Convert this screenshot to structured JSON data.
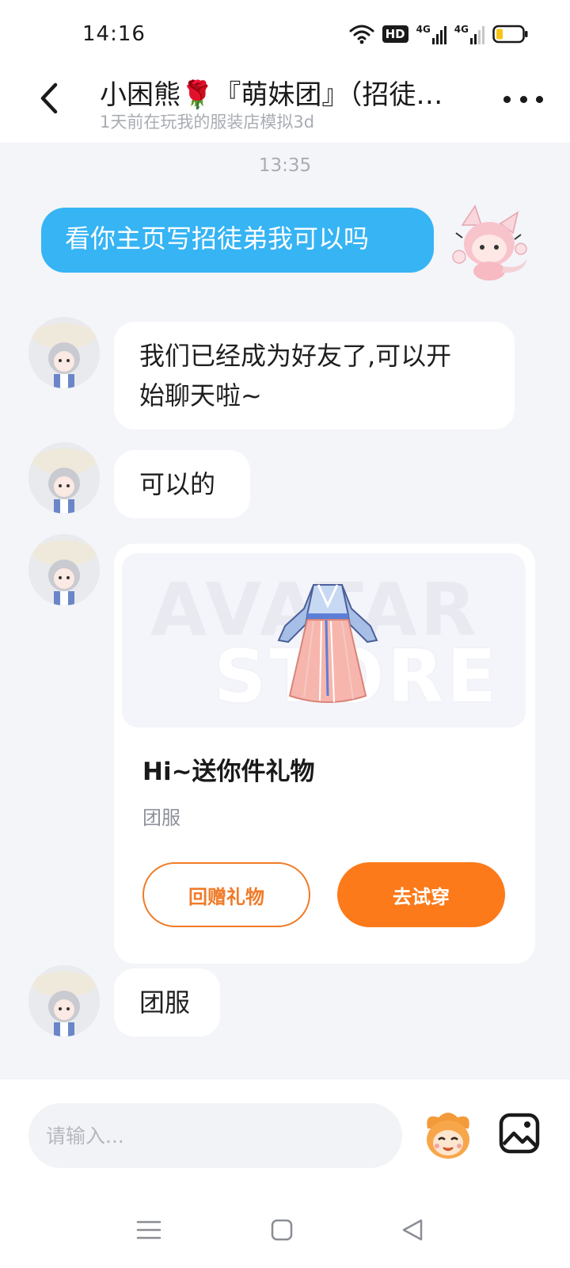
{
  "status_bar": {
    "time": "14:16",
    "network_1": "4G",
    "network_2": "4G",
    "hd_label": "HD"
  },
  "header": {
    "title": "小困熊🌹『萌妹团』（招徒…",
    "subtitle": "1天前在玩我的服装店模拟3d"
  },
  "chat": {
    "timestamp": "13:35",
    "messages": [
      {
        "sender": "me",
        "text": "看你主页写招徒弟我可以吗"
      },
      {
        "sender": "friend",
        "text_line1": "我们已经成为好友了,可以开",
        "text_line2": "始聊天啦~"
      },
      {
        "sender": "friend",
        "text": "可以的"
      },
      {
        "sender": "friend",
        "type": "gift",
        "watermark_1": "AVATAR",
        "watermark_2": "STORE",
        "title": "Hi~送你件礼物",
        "subtitle": "团服",
        "return_button": "回赠礼物",
        "try_button": "去试穿"
      },
      {
        "sender": "friend",
        "text": "团服"
      }
    ]
  },
  "input": {
    "placeholder": "请输入..."
  },
  "colors": {
    "outgoing_bubble": "#36b4f4",
    "accent_orange": "#fc7a1a",
    "background": "#f3f5f9"
  },
  "icons": {
    "back": "chevron-left-icon",
    "more": "more-dots-icon",
    "emoji": "emoji-mascot-icon",
    "image": "image-icon"
  }
}
